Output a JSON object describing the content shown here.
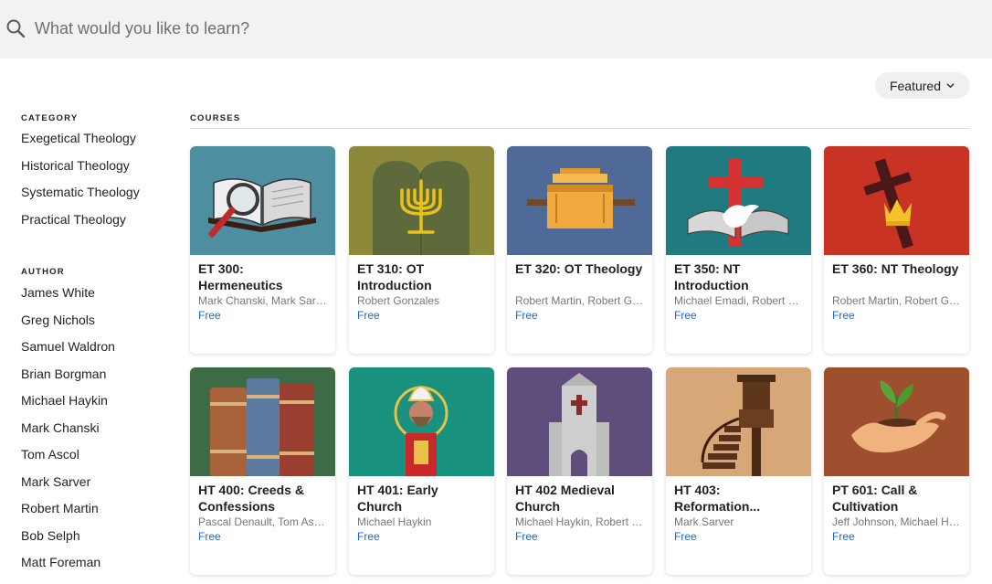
{
  "search": {
    "placeholder": "What would you like to learn?"
  },
  "sort": {
    "label": "Featured"
  },
  "sidebar": {
    "category_heading": "CATEGORY",
    "categories": [
      "Exegetical Theology",
      "Historical Theology",
      "Systematic Theology",
      "Practical Theology"
    ],
    "author_heading": "AUTHOR",
    "authors": [
      "James White",
      "Greg Nichols",
      "Samuel Waldron",
      "Brian Borgman",
      "Michael Haykin",
      "Mark Chanski",
      "Tom Ascol",
      "Mark Sarver",
      "Robert Martin",
      "Bob Selph",
      "Matt Foreman"
    ]
  },
  "main": {
    "heading": "COURSES",
    "courses": [
      {
        "title": "ET 300: Hermeneutics",
        "authors": "Mark Chanski, Mark Sarver",
        "price": "Free",
        "icon": "bible-magnifier-icon",
        "color": "#4d8ea0"
      },
      {
        "title": "ET 310: OT Introduction",
        "authors": "Robert Gonzales",
        "price": "Free",
        "icon": "menorah-icon",
        "color": "#8c8a3a"
      },
      {
        "title": "ET 320: OT Theology",
        "authors": "Robert Martin, Robert Gonzales",
        "price": "Free",
        "icon": "ark-icon",
        "color": "#4f6a98"
      },
      {
        "title": "ET 350: NT Introduction",
        "authors": "Michael Emadi, Robert Gonzales",
        "price": "Free",
        "icon": "cross-dove-icon",
        "color": "#1f7b80"
      },
      {
        "title": "ET 360: NT Theology",
        "authors": "Robert Martin, Robert Gonzales",
        "price": "Free",
        "icon": "cross-crown-icon",
        "color": "#c93324"
      },
      {
        "title": "HT 400: Creeds & Confessions",
        "authors": "Pascal Denault, Tom Ascol",
        "price": "Free",
        "icon": "books-icon",
        "color": "#3d6b45"
      },
      {
        "title": "HT 401: Early Church",
        "authors": "Michael Haykin",
        "price": "Free",
        "icon": "bishop-icon",
        "color": "#18917f"
      },
      {
        "title": "HT 402 Medieval Church",
        "authors": "Michael Haykin, Robert Martin",
        "price": "Free",
        "icon": "church-icon",
        "color": "#5f4d7e"
      },
      {
        "title": "HT 403: Reformation...",
        "authors": "Mark Sarver",
        "price": "Free",
        "icon": "pulpit-icon",
        "color": "#d8a778"
      },
      {
        "title": "PT 601: Call & Cultivation",
        "authors": "Jeff Johnson, Michael Haykin",
        "price": "Free",
        "icon": "hand-plant-icon",
        "color": "#9e4f2e"
      }
    ]
  }
}
